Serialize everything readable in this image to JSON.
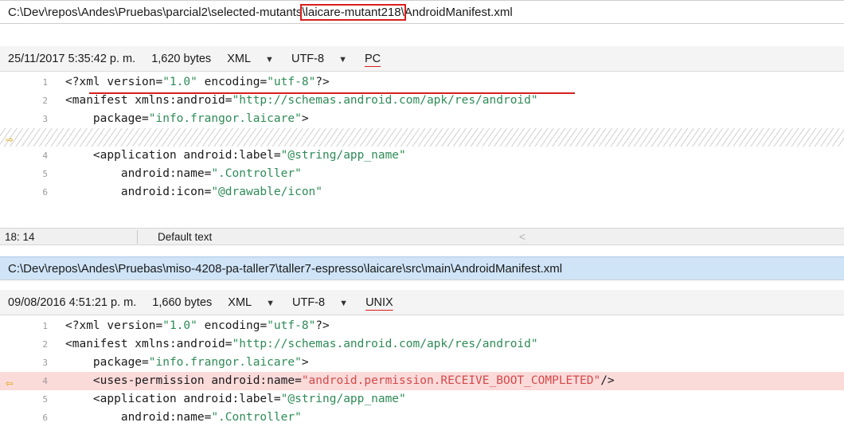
{
  "top_pane": {
    "path_prefix": "C:\\Dev\\repos\\Andes\\Pruebas\\parcial2\\selected-mutants",
    "path_highlight": "\\laicare-mutant218\\",
    "path_suffix": "AndroidManifest.xml",
    "date": "25/11/2017 5:35:42 p. m.",
    "size": "1,620 bytes",
    "format": "XML",
    "encoding": "UTF-8",
    "line_endings": "PC",
    "lines": [
      {
        "num": "1",
        "parts": [
          [
            "t",
            "<?xml version="
          ],
          [
            "v",
            "\"1.0\""
          ],
          [
            "t",
            " encoding="
          ],
          [
            "v",
            "\"utf-8\""
          ],
          [
            "t",
            "?>"
          ]
        ]
      },
      {
        "num": "2",
        "parts": [
          [
            "t",
            "<manifest xmlns:android="
          ],
          [
            "v",
            "\"http://schemas.android.com/apk/res/android\""
          ]
        ]
      },
      {
        "num": "3",
        "parts": [
          [
            "t",
            "    package="
          ],
          [
            "v",
            "\"info.frangor.laicare\""
          ],
          [
            "t",
            ">"
          ]
        ]
      },
      {
        "num": "",
        "parts": []
      },
      {
        "num": "4",
        "parts": [
          [
            "t",
            "    <application android:label="
          ],
          [
            "v",
            "\"@string/app_name\""
          ]
        ]
      },
      {
        "num": "5",
        "parts": [
          [
            "t",
            "        android:name="
          ],
          [
            "v",
            "\".Controller\""
          ]
        ]
      },
      {
        "num": "6",
        "parts": [
          [
            "t",
            "        android:icon="
          ],
          [
            "v",
            "\"@drawable/icon\""
          ]
        ]
      }
    ]
  },
  "status_bar": {
    "position": "18: 14",
    "mode": "Default text",
    "scroll_glyph": "<"
  },
  "bottom_pane": {
    "path": "C:\\Dev\\repos\\Andes\\Pruebas\\miso-4208-pa-taller7\\taller7-espresso\\laicare\\src\\main\\AndroidManifest.xml",
    "date": "09/08/2016 4:51:21 p. m.",
    "size": "1,660 bytes",
    "format": "XML",
    "encoding": "UTF-8",
    "line_endings": "UNIX",
    "lines": [
      {
        "num": "1",
        "parts": [
          [
            "t",
            "<?xml version="
          ],
          [
            "v",
            "\"1.0\""
          ],
          [
            "t",
            " encoding="
          ],
          [
            "v",
            "\"utf-8\""
          ],
          [
            "t",
            "?>"
          ]
        ]
      },
      {
        "num": "2",
        "parts": [
          [
            "t",
            "<manifest xmlns:android="
          ],
          [
            "v",
            "\"http://schemas.android.com/apk/res/android\""
          ]
        ]
      },
      {
        "num": "3",
        "parts": [
          [
            "t",
            "    package="
          ],
          [
            "v",
            "\"info.frangor.laicare\""
          ],
          [
            "t",
            ">"
          ]
        ]
      },
      {
        "num": "4",
        "parts": [
          [
            "t",
            "    <uses-permission android:name="
          ],
          [
            "v",
            "\"android.permission.RECEIVE_BOOT_COMPLETED\""
          ],
          [
            "t",
            "/>"
          ]
        ]
      },
      {
        "num": "5",
        "parts": [
          [
            "t",
            "    <application android:label="
          ],
          [
            "v",
            "\"@string/app_name\""
          ]
        ]
      },
      {
        "num": "6",
        "parts": [
          [
            "t",
            "        android:name="
          ],
          [
            "v",
            "\".Controller\""
          ]
        ]
      }
    ]
  },
  "icons": {
    "diff_arrow_right": "⇨",
    "diff_arrow_left": "⇦",
    "dropdown": "▼"
  },
  "colors": {
    "highlight_red": "#d81e1e",
    "removed_bg": "#fbdada",
    "xml_value": "#2e8b57",
    "arrow": "#d9a400"
  }
}
